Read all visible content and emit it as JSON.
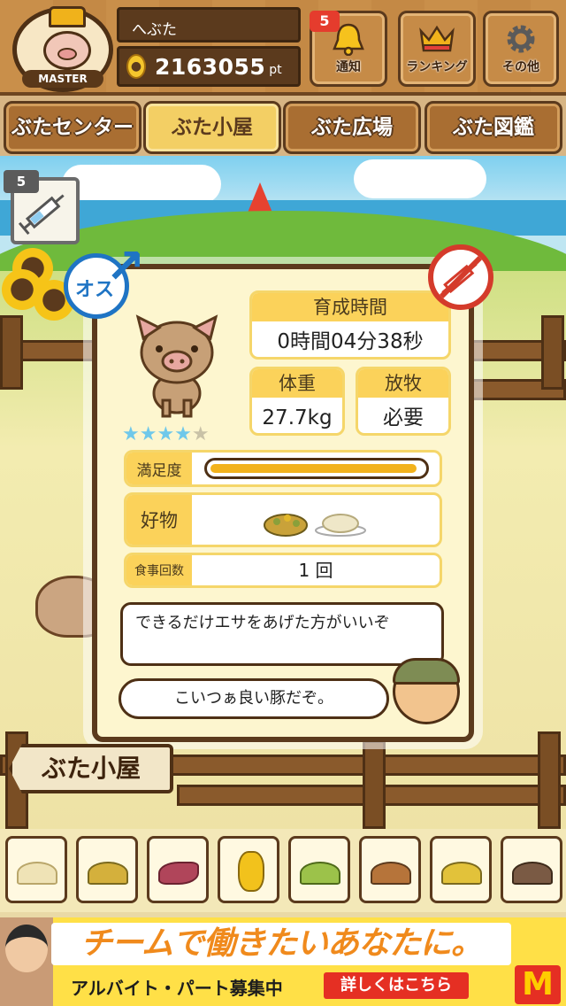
{
  "header": {
    "avatar_badge": "MASTER",
    "player_name": "へぶた",
    "points_value": "2163055",
    "points_unit": "pt",
    "notifications": {
      "label": "通知",
      "count": "5"
    },
    "ranking": {
      "label": "ランキング"
    },
    "other": {
      "label": "その他"
    }
  },
  "tabs": [
    {
      "label": "ぶたセンター",
      "active": false
    },
    {
      "label": "ぶた小屋",
      "active": true
    },
    {
      "label": "ぶた広場",
      "active": false
    },
    {
      "label": "ぶた図鑑",
      "active": false
    }
  ],
  "item_count": "5",
  "card": {
    "sex_label": "オス",
    "growth_time": {
      "label": "育成時間",
      "value": "0時間04分38秒"
    },
    "weight": {
      "label": "体重",
      "value": "27.7kg"
    },
    "grazing": {
      "label": "放牧",
      "value": "必要"
    },
    "rating": {
      "stars_on": "★★★★",
      "stars_off": "★"
    },
    "satisfaction": {
      "label": "満足度",
      "level": 0.97
    },
    "favorite": {
      "label": "好物"
    },
    "meals": {
      "label": "食事回数",
      "value": "1 回"
    },
    "advice": "できるだけエサをあげた方がいいぞ",
    "comment": "こいつぁ良い豚だぞ。"
  },
  "sign_text": "ぶた小屋",
  "ad": {
    "headline": "チームで働きたいあなたに。",
    "sub": "アルバイト・パート募集中",
    "cta": "詳しくはこちら",
    "logo": "M"
  },
  "colors": {
    "accent_yellow": "#fbd25a",
    "male_blue": "#1f74c4",
    "no_injection_red": "#d43b2b",
    "wood_dark": "#5b3a1d"
  }
}
